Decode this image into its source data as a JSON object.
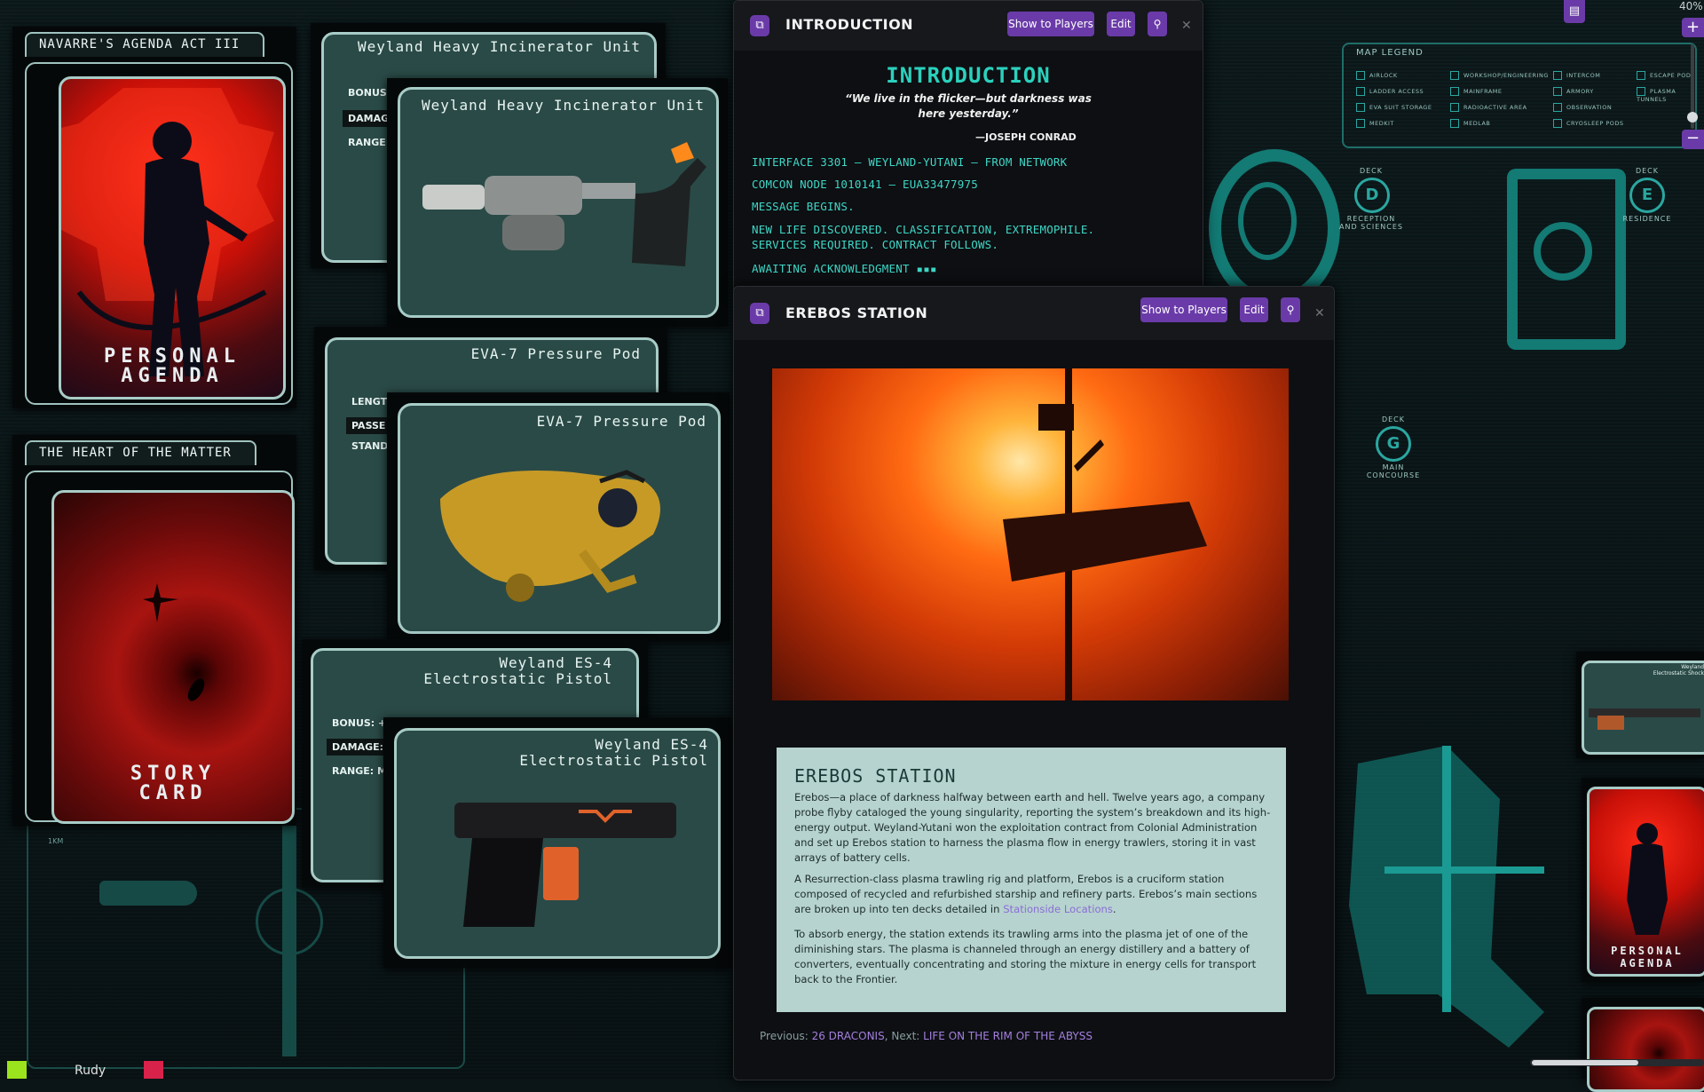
{
  "zoom": "40%",
  "cards": {
    "agenda": {
      "tab": "NAVARRE'S AGENDA ACT III",
      "caption_1": "PERSONAL",
      "caption_2": "AGENDA"
    },
    "story": {
      "tab": "THE HEART OF THE MATTER",
      "caption_1": "STORY",
      "caption_2": "CARD"
    },
    "incinerator": {
      "title": "Weyland Heavy Incinerator Unit",
      "stat_1": "BONUS:",
      "stat_2": "DAMAG",
      "stat_3": "RANGE:"
    },
    "eva": {
      "title": "EVA-7 Pressure Pod",
      "stat_1": "LENGT",
      "stat_2": "PASSE",
      "stat_3": "STAND"
    },
    "pistol": {
      "title_1": "Weyland ES-4",
      "title_2": "Electrostatic Pistol",
      "stat_1": "BONUS: +",
      "stat_2": "DAMAGE: ",
      "stat_3": "RANGE: M"
    },
    "small_right": {
      "title_1": "Weyland",
      "title_2": "Electrostatic Shock",
      "caption_1": "PERSONAL",
      "caption_2": "AGENDA"
    }
  },
  "intro_window": {
    "title": "INTRODUCTION",
    "show_label": "Show to Players",
    "edit_label": "Edit",
    "heading": "INTRODUCTION",
    "quote_1": "“We live in the flicker—but darkness was",
    "quote_2": "here yesterday.”",
    "attribution": "—JOSEPH CONRAD",
    "line_1": "INTERFACE 3301 — WEYLAND-YUTANI — FROM NETWORK",
    "line_2": "COMCON NODE 1010141 — EUA33477975",
    "line_3": "MESSAGE BEGINS.",
    "line_4": "NEW LIFE DISCOVERED. CLASSIFICATION, EXTREMOPHILE.",
    "line_5": "SERVICES REQUIRED. CONTRACT FOLLOWS.",
    "line_6": "AWAITING ACKNOWLEDGMENT ▪▪▪"
  },
  "erebos_window": {
    "title": "EREBOS STATION",
    "show_label": "Show to Players",
    "edit_label": "Edit",
    "box_heading": "EREBOS STATION",
    "p1": "Erebos—a place of darkness halfway between earth and hell. Twelve years ago, a company probe flyby cataloged the young singularity, reporting the system’s breakdown and its high-energy output. Weyland-Yutani won the exploitation contract from Colonial Administration and set up Erebos station to harness the plasma flow in energy trawlers, storing it in vast arrays of battery cells.",
    "p2_before": "A Resurrection-class plasma trawling rig and platform, Erebos is a cruciform station composed of recycled and refurbished starship and refinery parts. Erebos’s main sections are broken up into ten decks detailed in ",
    "p2_link": "Stationside Locations",
    "p2_after": ".",
    "p3": "To absorb energy, the station extends its trawling arms into the plasma jet of one of the diminishing stars. The plasma is channeled through an energy distillery and a battery of converters, eventually concentrating and storing the mixture in energy cells for transport back to the Frontier.",
    "prev_label": "Previous: ",
    "prev_link": "26 DRACONIS",
    "next_label": ", Next: ",
    "next_link": "LIFE ON THE RIM OF THE ABYSS"
  },
  "map": {
    "legend_title": "MAP LEGEND",
    "legend": [
      "AIRLOCK",
      "LADDER ACCESS",
      "EVA SUIT STORAGE",
      "MEDKIT",
      "WORKSHOP/ENGINEERING",
      "MAINFRAME",
      "RADIOACTIVE AREA",
      "MEDLAB",
      "INTERCOM",
      "ARMORY",
      "OBSERVATION",
      "CRYOSLEEP PODS",
      "ESCAPE POD",
      "PLASMA TUNNELS"
    ],
    "deck_d": "D",
    "deck_d_name_1": "RECEPTION",
    "deck_d_name_2": "AND SCIENCES",
    "deck_e": "E",
    "deck_e_name": "RESIDENCE",
    "deck_g": "G",
    "deck_g_name_1": "MAIN",
    "deck_g_name_2": "CONCOURSE",
    "deck_word": "DECK",
    "scale": "1KM"
  },
  "player": {
    "name": "Rudy",
    "color": "#d8224a",
    "self_color": "#9be31c"
  },
  "colors": {
    "accent": "#6a3ba8",
    "terminal": "#3fd7c7",
    "card_bg": "#2a4a47"
  }
}
